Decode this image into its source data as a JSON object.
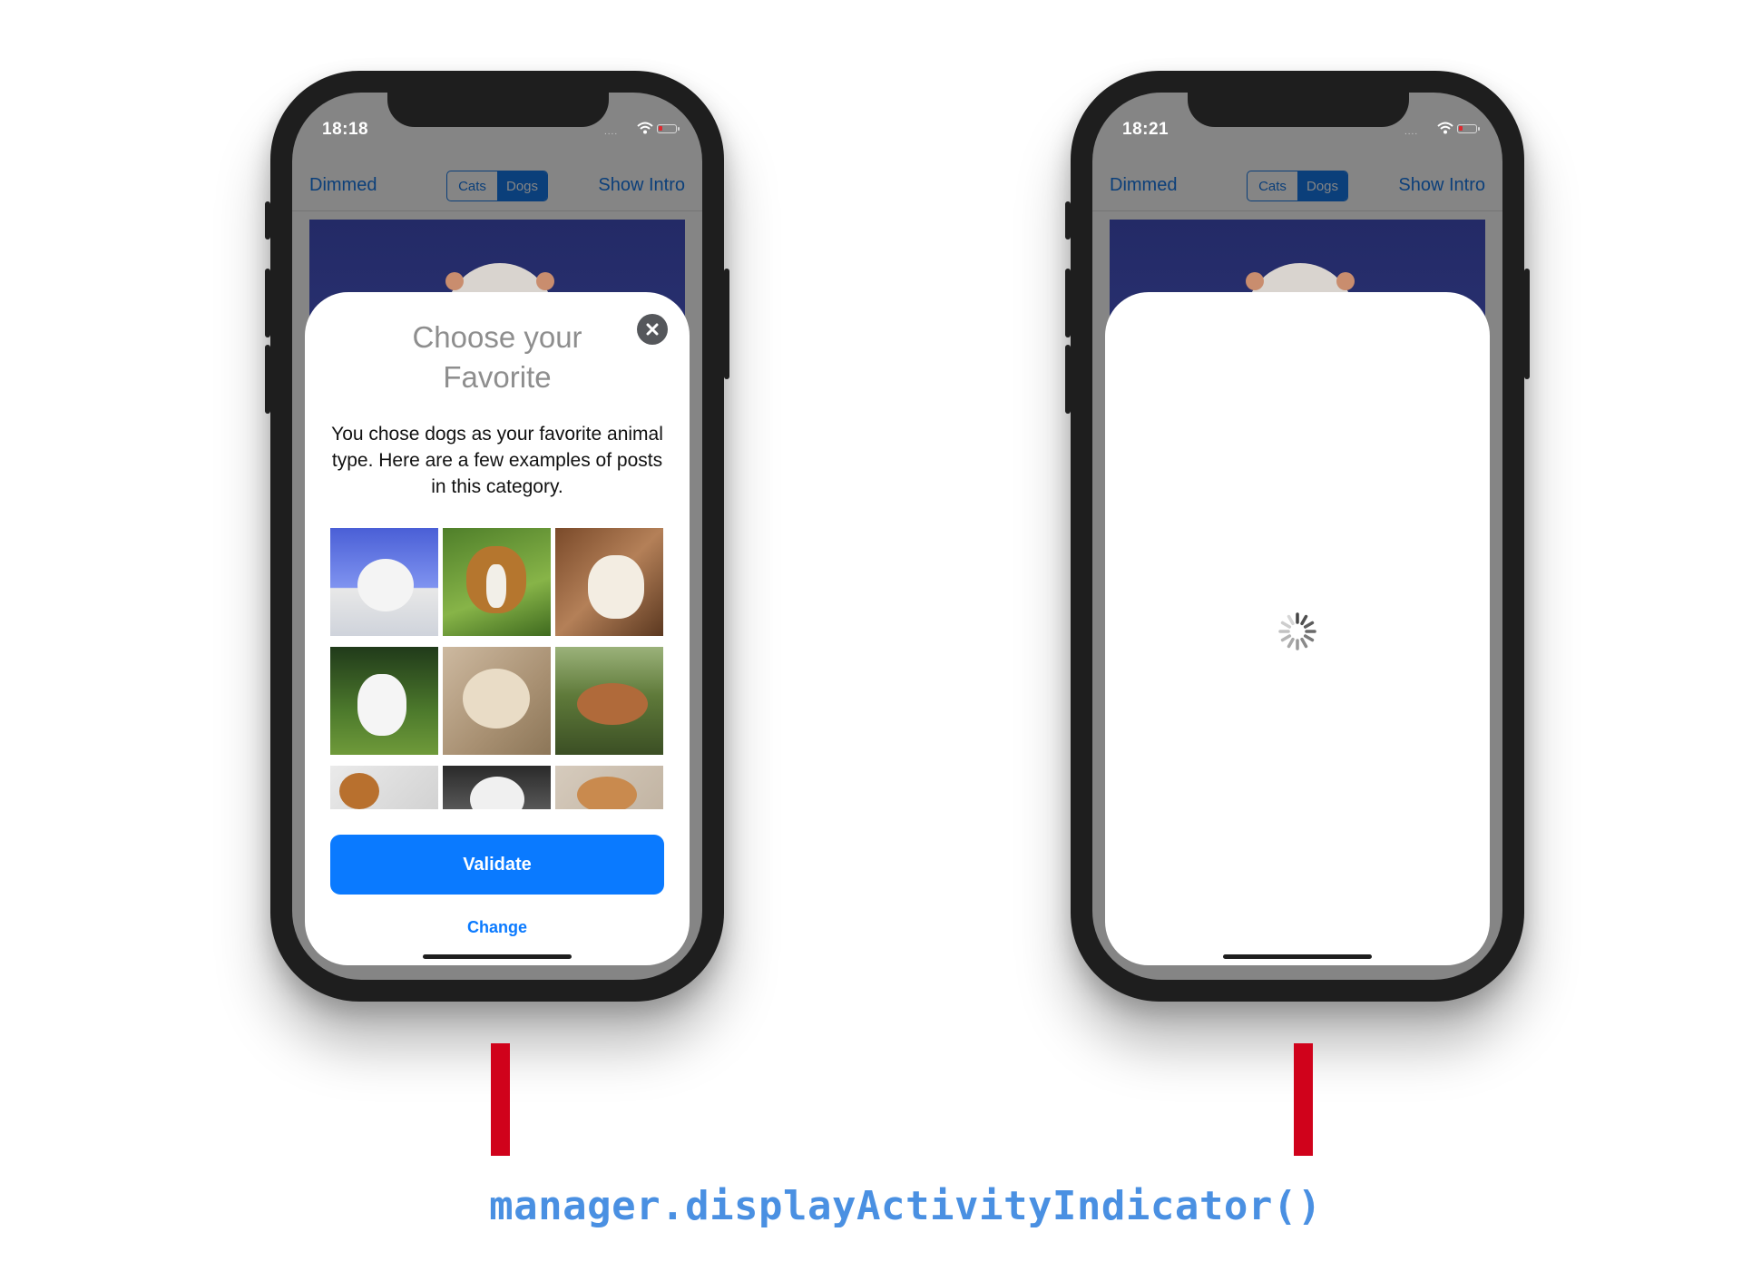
{
  "phones": [
    {
      "status_bar": {
        "time": "18:18"
      },
      "navbar": {
        "left_label": "Dimmed",
        "segments": [
          "Cats",
          "Dogs"
        ],
        "selected_segment": "Dogs",
        "right_label": "Show Intro"
      },
      "card": {
        "state": "content",
        "title": "Choose your Favorite",
        "body": "You chose dogs as your favorite animal type. Here are a few examples of posts in this category.",
        "photo_count": 9,
        "primary_button": "Validate",
        "secondary_button": "Change",
        "close_icon": "close-icon"
      }
    },
    {
      "status_bar": {
        "time": "18:21"
      },
      "navbar": {
        "left_label": "Dimmed",
        "segments": [
          "Cats",
          "Dogs"
        ],
        "selected_segment": "Dogs",
        "right_label": "Show Intro"
      },
      "card": {
        "state": "loading",
        "indicator_icon": "activity-indicator-icon"
      }
    }
  ],
  "caption": "manager.displayActivityIndicator()",
  "colors": {
    "accent": "#0a7aff",
    "navbar_tint": "#0b3f7a",
    "marker": "#d0021b",
    "caption": "#4a90e2",
    "phone_body": "#1e1e1e"
  }
}
